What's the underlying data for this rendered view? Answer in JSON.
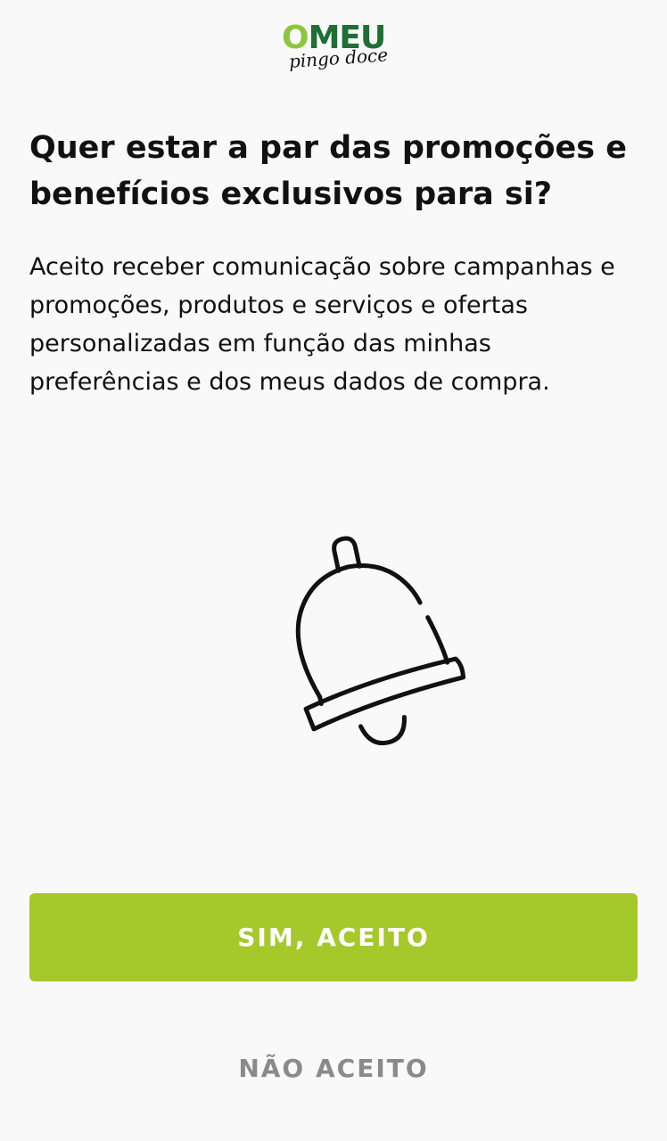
{
  "logo": {
    "first_letter": "O",
    "rest": "MEU",
    "script": "pingo doce"
  },
  "title": "Quer estar a par das promoções e benefícios exclusivos para si?",
  "description": "Aceito receber comunicação sobre campanhas e promoções, produtos e serviços e ofertas personalizadas em função das minhas preferências e dos meus dados de compra.",
  "illustration": {
    "icon": "bell-icon"
  },
  "buttons": {
    "accept_label": "SIM, ACEITO",
    "decline_label": "NÃO ACEITO"
  },
  "colors": {
    "background": "#f9f9f9",
    "accent": "#a5c82a",
    "logo_dark_green": "#1f6e35",
    "logo_light_green": "#8cc63f",
    "secondary_text": "#8a8a8a"
  }
}
